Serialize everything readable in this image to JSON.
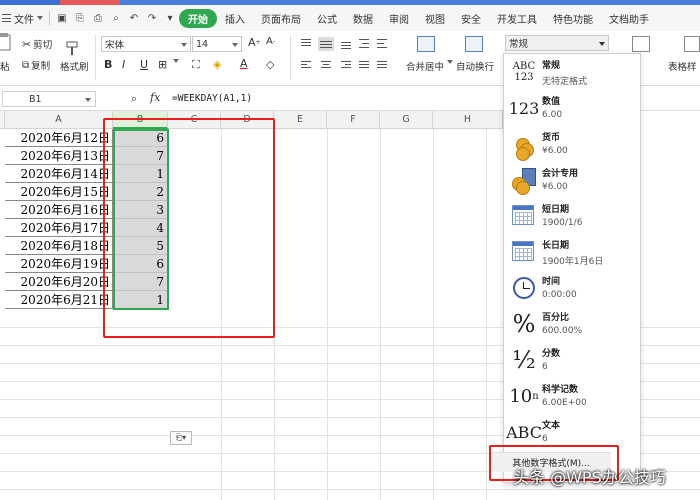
{
  "menubar": {
    "file_label": "文件",
    "tabs": [
      "开始",
      "插入",
      "页面布局",
      "公式",
      "数据",
      "审阅",
      "视图",
      "安全",
      "开发工具",
      "特色功能",
      "文档助手"
    ],
    "active_tab": "开始"
  },
  "ribbon": {
    "cut": "剪切",
    "copy": "复制",
    "format_painter": "格式刷",
    "paste": "粘",
    "font_name": "宋体",
    "font_size": "14",
    "merge_center": "合并居中",
    "wrap_text": "自动换行",
    "number_format": "常规",
    "table_style": "表格样"
  },
  "formula_bar": {
    "name_box": "B1",
    "fx": "fx",
    "formula": "=WEEKDAY(A1,1)"
  },
  "columns": [
    "A",
    "B",
    "C",
    "D",
    "E",
    "F",
    "G",
    "H"
  ],
  "rows": [
    {
      "date": "2020年6月12日",
      "weekday": "6"
    },
    {
      "date": "2020年6月13日",
      "weekday": "7"
    },
    {
      "date": "2020年6月14日",
      "weekday": "1"
    },
    {
      "date": "2020年6月15日",
      "weekday": "2"
    },
    {
      "date": "2020年6月16日",
      "weekday": "3"
    },
    {
      "date": "2020年6月17日",
      "weekday": "4"
    },
    {
      "date": "2020年6月18日",
      "weekday": "5"
    },
    {
      "date": "2020年6月19日",
      "weekday": "6"
    },
    {
      "date": "2020年6月20日",
      "weekday": "7"
    },
    {
      "date": "2020年6月21日",
      "weekday": "1"
    }
  ],
  "number_formats": [
    {
      "name": "常规",
      "sample": "无特定格式",
      "icon": "ABC\n123"
    },
    {
      "name": "数值",
      "sample": "6.00",
      "icon": "123"
    },
    {
      "name": "货币",
      "sample": "¥6.00",
      "icon": "coins"
    },
    {
      "name": "会计专用",
      "sample": "¥6.00",
      "icon": "coins-calc"
    },
    {
      "name": "短日期",
      "sample": "1900/1/6",
      "icon": "calendar"
    },
    {
      "name": "长日期",
      "sample": "1900年1月6日",
      "icon": "calendar"
    },
    {
      "name": "时间",
      "sample": "0:00:00",
      "icon": "clock"
    },
    {
      "name": "百分比",
      "sample": "600.00%",
      "icon": "%"
    },
    {
      "name": "分数",
      "sample": "6",
      "icon": "½"
    },
    {
      "name": "科学记数",
      "sample": "6.00E+00",
      "icon": "10ⁿ"
    },
    {
      "name": "文本",
      "sample": "6",
      "icon": "ABC"
    }
  ],
  "more_formats": "其他数字格式(M)...",
  "watermark": "头条 @WPS办公技巧",
  "colors": {
    "accent_green": "#2fa84f",
    "highlight_red": "#e8201c",
    "selection_gray": "#d9d9d9"
  }
}
